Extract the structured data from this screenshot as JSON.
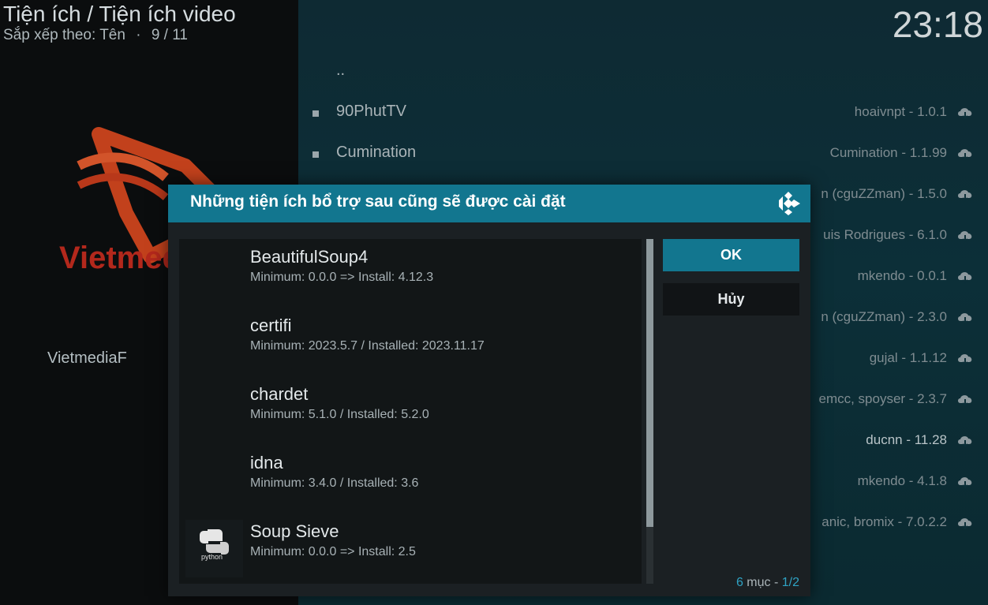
{
  "header": {
    "title": "Tiện ích / Tiện ích video",
    "sort_label": "Sắp xếp theo: Tên",
    "separator": "·",
    "position": "9 / 11"
  },
  "clock": "23:18",
  "addon_preview": {
    "logo_text": "Vietmed",
    "label": "VietmediaF"
  },
  "background_list": [
    {
      "name": "..",
      "meta": "",
      "bullet": false
    },
    {
      "name": "90PhutTV",
      "meta": "hoaivnpt - 1.0.1",
      "bullet": true
    },
    {
      "name": "Cumination",
      "meta": "Cumination - 1.1.99",
      "bullet": true
    },
    {
      "name": "",
      "meta": "n (cguZZman) - 1.5.0",
      "bullet": false
    },
    {
      "name": "",
      "meta": "uis Rodrigues - 6.1.0",
      "bullet": false
    },
    {
      "name": "",
      "meta": "mkendo - 0.0.1",
      "bullet": false
    },
    {
      "name": "",
      "meta": "n (cguZZman) - 2.3.0",
      "bullet": false
    },
    {
      "name": "",
      "meta": "gujal - 1.1.12",
      "bullet": false
    },
    {
      "name": "",
      "meta": "emcc, spoyser - 2.3.7",
      "bullet": false
    },
    {
      "name": "",
      "meta": "ducnn - 11.28",
      "bullet": false,
      "bright": true
    },
    {
      "name": "",
      "meta": "mkendo - 4.1.8",
      "bullet": false
    },
    {
      "name": "",
      "meta": "anic, bromix - 7.0.2.2",
      "bullet": false
    }
  ],
  "dialog": {
    "title": "Những tiện ích bổ trợ sau cũng sẽ được cài đặt",
    "items": [
      {
        "title": "BeautifulSoup4",
        "detail": "Minimum: 0.0.0 => Install: 4.12.3",
        "thumb": false
      },
      {
        "title": "certifi",
        "detail": "Minimum: 2023.5.7 / Installed: 2023.11.17",
        "thumb": false
      },
      {
        "title": "chardet",
        "detail": "Minimum: 5.1.0 / Installed: 5.2.0",
        "thumb": false
      },
      {
        "title": "idna",
        "detail": "Minimum: 3.4.0 / Installed: 3.6",
        "thumb": false
      },
      {
        "title": "Soup Sieve",
        "detail": "Minimum: 0.0.0 => Install: 2.5",
        "thumb": true
      }
    ],
    "thumb_text": "python",
    "ok_label": "OK",
    "cancel_label": "Hủy",
    "count_num": "6",
    "count_label": " mục - ",
    "page": "1/2"
  },
  "colors": {
    "accent": "#12768f",
    "highlight_text": "#2fa3c4"
  }
}
